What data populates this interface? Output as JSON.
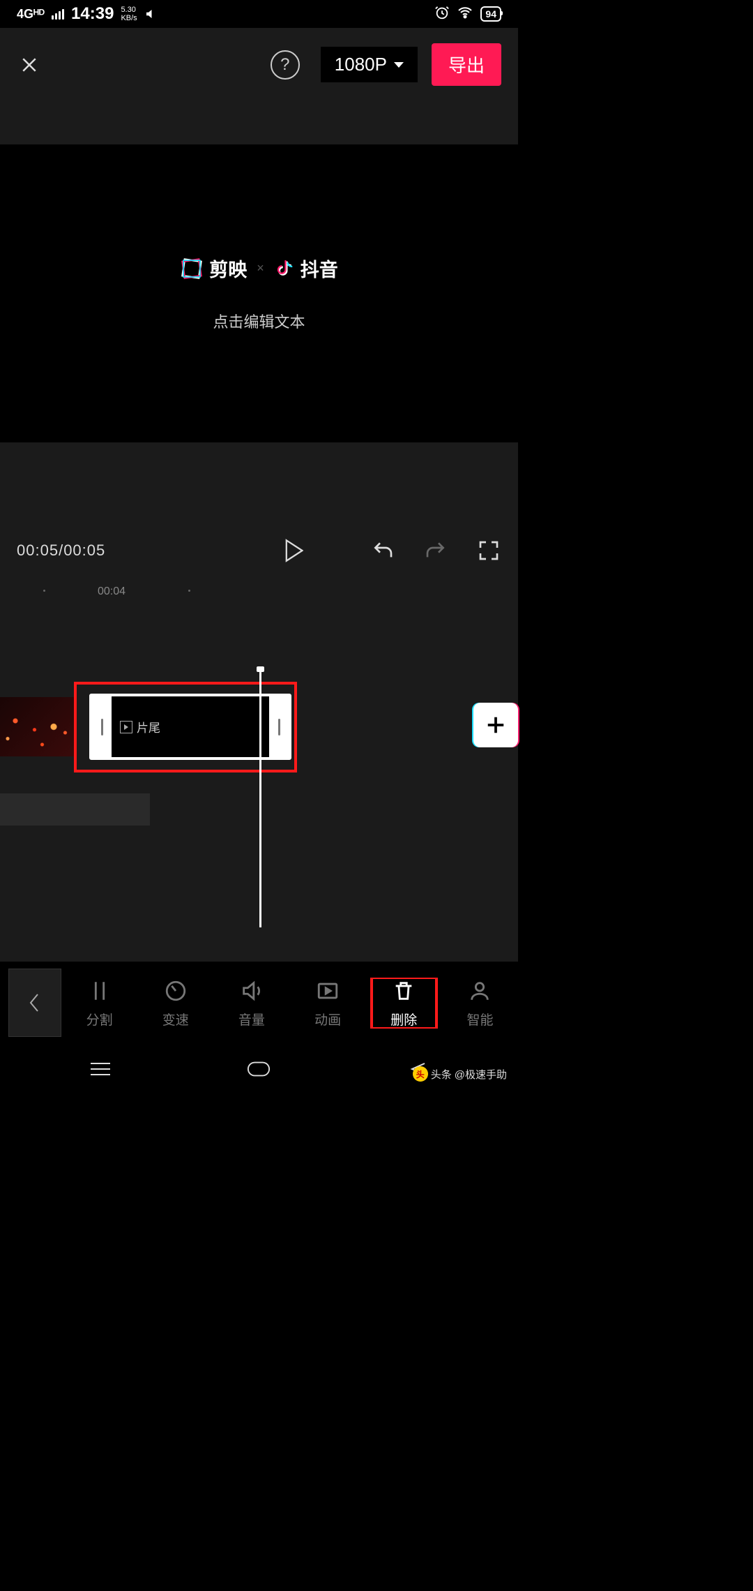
{
  "status": {
    "network_label": "4Gᴴᴰ",
    "time": "14:39",
    "speed_top": "5.30",
    "speed_bot": "KB/s",
    "battery": "94"
  },
  "header": {
    "resolution": "1080P",
    "export_label": "导出"
  },
  "preview": {
    "brand1": "剪映",
    "brand2": "抖音",
    "separator": "×",
    "edit_prompt": "点击编辑文本"
  },
  "controls": {
    "current_time": "00:05",
    "total_time": "00:05"
  },
  "timeline": {
    "tick_label": "00:04",
    "ending_label": "片尾"
  },
  "tools": [
    {
      "id": "split",
      "label": "分割"
    },
    {
      "id": "speed",
      "label": "变速"
    },
    {
      "id": "volume",
      "label": "音量"
    },
    {
      "id": "animation",
      "label": "动画"
    },
    {
      "id": "delete",
      "label": "删除"
    },
    {
      "id": "smart",
      "label": "智能"
    }
  ],
  "watermark": {
    "prefix": "头条",
    "author": "@极速手助"
  }
}
